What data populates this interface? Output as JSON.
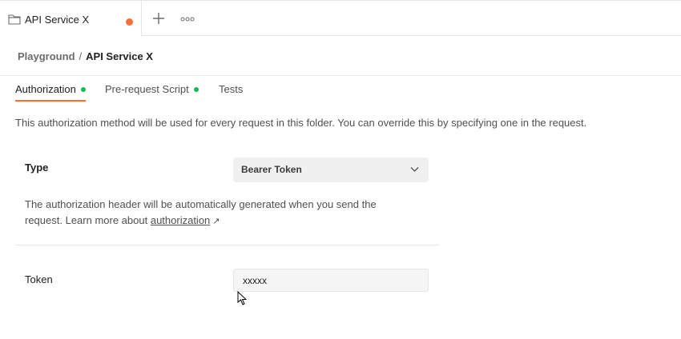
{
  "tabbar": {
    "tab": {
      "title": "API Service X",
      "icon": "folder-icon",
      "unsaved_dot_color": "#ff6c37"
    },
    "new_tab_icon": "plus-icon",
    "more_icon": "more-horizontal-icon"
  },
  "breadcrumb": {
    "parent": "Playground",
    "separator": "/",
    "current": "API Service X"
  },
  "subtabs": [
    {
      "label": "Authorization",
      "active": true,
      "indicator": true
    },
    {
      "label": "Pre-request Script",
      "active": false,
      "indicator": true
    },
    {
      "label": "Tests",
      "active": false,
      "indicator": false
    }
  ],
  "colors": {
    "accent": "#ff6c37",
    "indicator": "#0cbb52"
  },
  "description": "This authorization method will be used for every request in this folder. You can override this by specifying one in the request.",
  "auth": {
    "type_label": "Type",
    "type_value": "Bearer Token",
    "help_text": "The authorization header will be automatically generated when you send the request. Learn more about",
    "help_link": "authorization",
    "help_link_icon": "external-arrow-icon",
    "token_label": "Token",
    "token_value": "xxxxx"
  }
}
